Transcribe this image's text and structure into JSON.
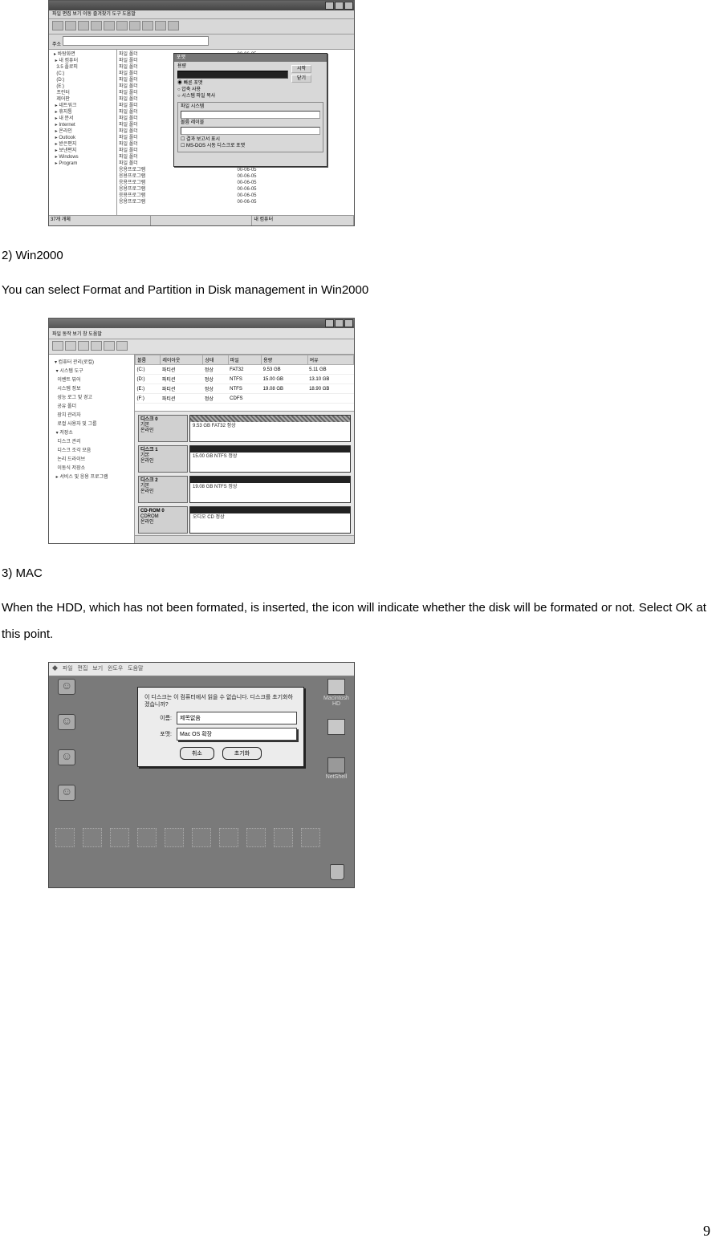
{
  "page_number": "9",
  "section2_heading": "2) Win2000",
  "section2_text": "You can select Format and Partition in Disk management in Win2000",
  "section3_heading": "3) MAC",
  "section3_text": "When the HDD, which has not been formated, is inserted, the icon will indicate whether the disk will be formated or not. Select OK at this point.",
  "fig1": {
    "dialog_title": "포맷",
    "button_start": "시작",
    "button_close": "닫기",
    "group1": "용량",
    "group2": "파일 시스템",
    "group3": "볼륨 레이블",
    "opt1": "빠른 포맷",
    "opt2": "압축 사용",
    "opt3": "시스템 파일 복사"
  },
  "fig2": {
    "grid": {
      "headers": [
        "볼륨",
        "레이아웃",
        "상태",
        "파일",
        "용량",
        "여유"
      ],
      "rows": [
        [
          "(C:)",
          "파티션",
          "정상",
          "FAT32",
          "9.53 GB",
          "5.11 GB"
        ],
        [
          "(D:)",
          "파티션",
          "정상",
          "NTFS",
          "15.00 GB",
          "13.10 GB"
        ],
        [
          "(E:)",
          "파티션",
          "정상",
          "NTFS",
          "19.08 GB",
          "18.90 GB"
        ],
        [
          "(F:)",
          "파티션",
          "정상",
          "CDFS",
          "",
          ""
        ]
      ]
    },
    "disks": [
      {
        "label": "디스크 0",
        "sub": "기본",
        "status": "온라인",
        "bar": "9.53 GB  FAT32  정상",
        "hatched": true
      },
      {
        "label": "디스크 1",
        "sub": "기본",
        "status": "온라인",
        "bar": "15.00 GB  NTFS  정상",
        "hatched": false
      },
      {
        "label": "디스크 2",
        "sub": "기본",
        "status": "온라인",
        "bar": "19.08 GB  NTFS  정상",
        "hatched": false
      },
      {
        "label": "CD-ROM 0",
        "sub": "CDROM",
        "status": "온라인",
        "bar": "오디오 CD  정상",
        "hatched": false
      }
    ]
  },
  "fig3": {
    "msg": "이 디스크는 이 컴퓨터에서 읽을 수 없습니다. 디스크를 초기화하겠습니까?",
    "label_name": "이름:",
    "label_format": "포맷:",
    "name_value": "제목없음",
    "format_value": "Mac OS 확장",
    "button_cancel": "취소",
    "button_ok": "초기화",
    "icon_hd": "Macintosh HD",
    "icon_netshell": "NetShell"
  }
}
